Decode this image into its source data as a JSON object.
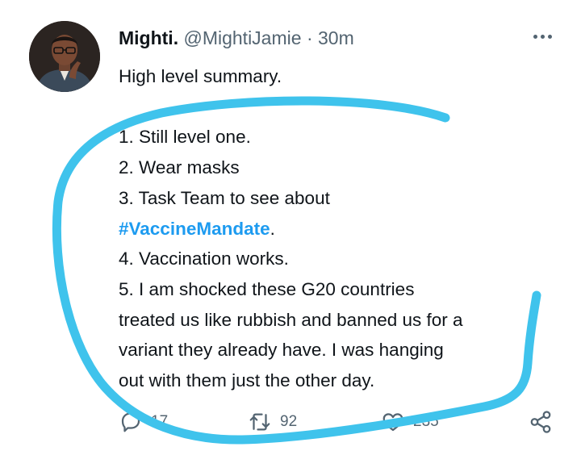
{
  "tweet": {
    "author_name": "Mighti.",
    "author_handle": "@MightiJamie",
    "separator": "·",
    "timestamp": "30m",
    "lines": {
      "intro": "High level summary.",
      "item1": "1. Still level one.",
      "item2": "2. Wear masks",
      "item3": "3. Task Team to see about",
      "hashtag": "#VaccineMandate",
      "hashtag_suffix": ".",
      "item4": "4. Vaccination works.",
      "item5_line1": "5. I am shocked these G20 countries",
      "item5_line2": "treated us like rubbish and banned us for a",
      "item5_line3": "variant they already have. I was hanging",
      "item5_line4": "out with them just the other day."
    },
    "actions": {
      "reply_count": "17",
      "retweet_count": "92",
      "like_count": "235"
    }
  },
  "icons": {
    "more": "more-dots-icon",
    "reply": "reply-icon",
    "retweet": "retweet-icon",
    "like": "heart-icon",
    "share": "share-icon"
  },
  "colors": {
    "hashtag": "#1d9bf0",
    "secondary_text": "#536471",
    "annotation_stroke": "#3fc3ec"
  }
}
